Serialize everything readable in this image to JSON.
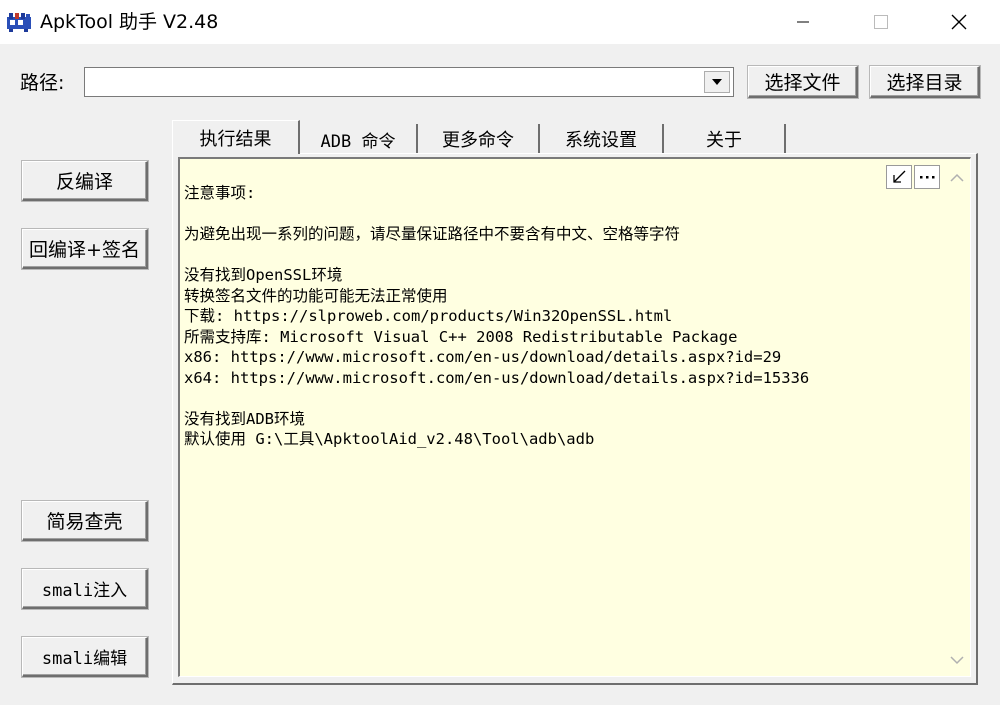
{
  "window": {
    "title": "ApkTool 助手 V2.48",
    "icons": [
      "app-icon",
      "minimize-icon",
      "maximize-icon",
      "close-icon"
    ]
  },
  "path": {
    "label": "路径:",
    "value": "",
    "select_file_label": "选择文件",
    "select_dir_label": "选择目录"
  },
  "sidebar": {
    "decompile_label": "反编译",
    "recompile_sign_label": "回编译+签名",
    "shell_check_label": "简易查壳",
    "smali_inject_label": "smali注入",
    "smali_edit_label": "smali编辑"
  },
  "tabs": [
    {
      "label": "执行结果",
      "active": true
    },
    {
      "label": "ADB 命令",
      "active": false
    },
    {
      "label": "更多命令",
      "active": false
    },
    {
      "label": "系统设置",
      "active": false
    },
    {
      "label": "关于",
      "active": false
    }
  ],
  "output": {
    "background": "#ffffe1",
    "lines": [
      "注意事项:",
      "",
      "为避免出现一系列的问题，请尽量保证路径中不要含有中文、空格等字符",
      "",
      "没有找到OpenSSL环境",
      "转换签名文件的功能可能无法正常使用",
      "下载: https://slproweb.com/products/Win32OpenSSL.html",
      "所需支持库: Microsoft Visual C++ 2008 Redistributable Package",
      "x86: https://www.microsoft.com/en-us/download/details.aspx?id=29",
      "x64: https://www.microsoft.com/en-us/download/details.aspx?id=15336",
      "",
      "没有找到ADB环境",
      "默认使用 G:\\工具\\ApktoolAid_v2.48\\Tool\\adb\\adb"
    ]
  }
}
